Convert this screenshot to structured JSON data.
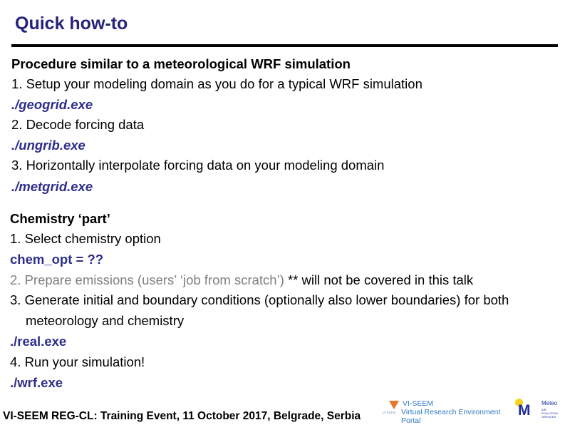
{
  "slide": {
    "title": "Quick how-to",
    "section1": {
      "heading": "Procedure similar to a meteorological WRF simulation",
      "steps": [
        {
          "text": "1. Setup your modeling domain as you do for a typical WRF simulation",
          "command": "./geogrid.exe"
        },
        {
          "text": "2. Decode forcing data",
          "command": "./ungrib.exe"
        },
        {
          "text": "3. Horizontally interpolate forcing data on your modeling domain",
          "command": "./metgrid.exe"
        }
      ]
    },
    "section2": {
      "heading": "Chemistry ‘part’",
      "step1": {
        "text": "1. Select chemistry option",
        "command": "chem_opt = ??"
      },
      "step2": {
        "text_gray": "2. Prepare emissions (users’ ‘job from scratch’)",
        "text_black": " ** will not be covered in this talk"
      },
      "step3": {
        "text": "3. Generate initial and boundary conditions (optionally also lower boundaries) for both",
        "text_cont": "meteorology and chemistry",
        "command": "./real.exe"
      },
      "step4": {
        "text": "4. Run your simulation!",
        "command": "./wrf.exe"
      }
    },
    "footer": {
      "text": "VI-SEEM REG-CL: Training Event, 11 October 2017, Belgrade, Serbia"
    },
    "logos": {
      "viseem": {
        "name": "VI-SEEM",
        "subtitle": "Virtual Research Environment Portal",
        "small": "VI-SEEM"
      },
      "meteo": {
        "letter": "M",
        "name": "Meteo",
        "small": "AIR POLLUTION SERVICES"
      }
    },
    "colors": {
      "title": "#25237a",
      "command": "#2e2e8c",
      "muted": "#7f7f7f"
    }
  }
}
